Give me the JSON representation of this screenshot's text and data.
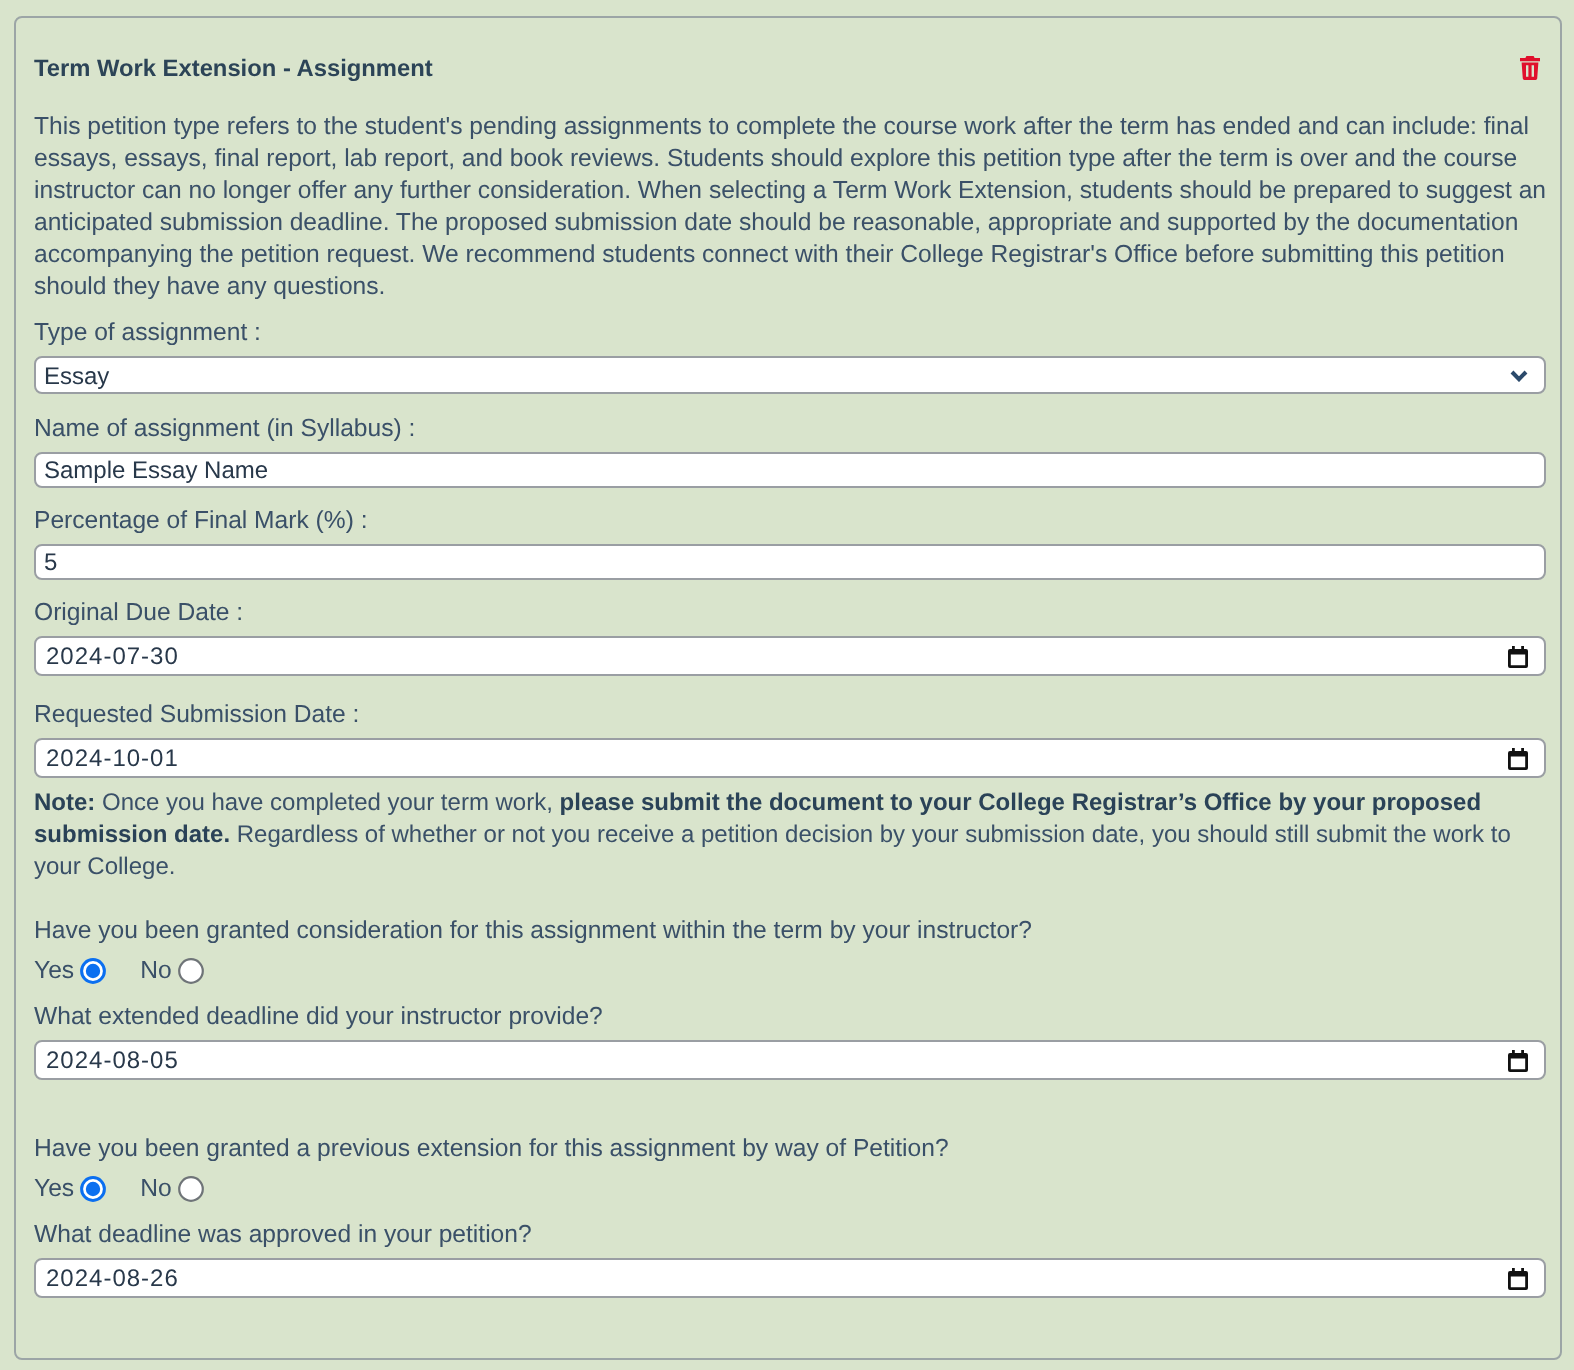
{
  "form": {
    "title": "Term Work Extension - Assignment",
    "description": "This petition type refers to the student's pending assignments to complete the course work after the term has ended and can include: final essays, essays, final report, lab report, and book reviews. Students should explore this petition type after the term is over and the course instructor can no longer offer any further consideration. When selecting a Term Work Extension, students should be prepared to suggest an anticipated submission deadline. The proposed submission date should be reasonable, appropriate and supported by the documentation accompanying the petition request. We recommend students connect with their College Registrar's Office before submitting this petition should they have any questions."
  },
  "fields": [
    {
      "kind": "select",
      "label": "Type of assignment :",
      "value": "Essay"
    },
    {
      "kind": "text",
      "label": "Name of assignment (in Syllabus) :",
      "value": "Sample Essay Name"
    },
    {
      "kind": "text",
      "label": "Percentage of Final Mark (%) :",
      "value": "5"
    },
    {
      "kind": "date",
      "label": "Original Due Date :",
      "value": "2024-07-30"
    },
    {
      "kind": "date",
      "label": "Requested Submission Date :",
      "value": "2024-10-01"
    }
  ],
  "note": "**Note:** Once you have completed your term work, **please submit the document to your College Registrar’s Office by your proposed submission date.** Regardless of whether or not you receive a petition decision by your submission date, you should still submit the work to your College.",
  "questions": [
    {
      "question": "Have you been granted consideration for this assignment within the term by your instructor?",
      "options": [
        {
          "label": "Yes",
          "selected": true
        },
        {
          "label": "No",
          "selected": false
        }
      ],
      "follow_up": {
        "kind": "date",
        "label": "What extended deadline did your instructor provide?",
        "value": "2024-08-05"
      }
    },
    {
      "question": "Have you been granted a previous extension for this assignment by way of Petition?",
      "options": [
        {
          "label": "Yes",
          "selected": true
        },
        {
          "label": "No",
          "selected": false
        }
      ],
      "follow_up": {
        "kind": "date",
        "label": "What deadline was approved in your petition?",
        "value": "2024-08-26"
      }
    }
  ]
}
